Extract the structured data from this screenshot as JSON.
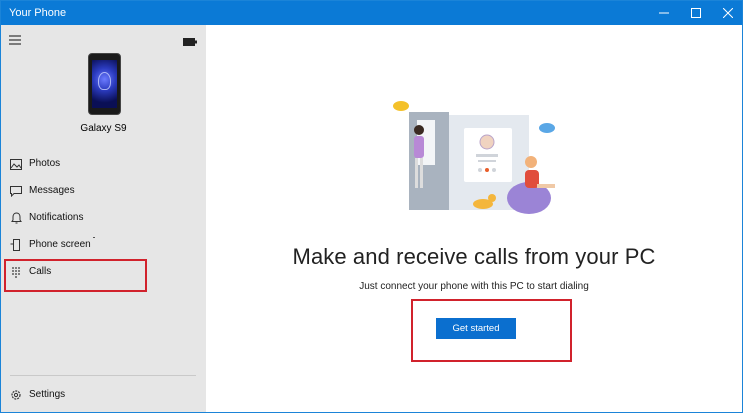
{
  "window": {
    "title": "Your Phone",
    "controls": [
      "minimize-icon",
      "maximize-icon",
      "close-icon"
    ]
  },
  "sidebar": {
    "device_name": "Galaxy S9",
    "items": [
      {
        "label": "Photos",
        "icon": "photos-icon"
      },
      {
        "label": "Messages",
        "icon": "messages-icon"
      },
      {
        "label": "Notifications",
        "icon": "bell-icon"
      },
      {
        "label": "Phone screen",
        "icon": "phone-screen-icon"
      },
      {
        "label": "Calls",
        "icon": "dialpad-icon"
      }
    ],
    "settings_label": "Settings"
  },
  "main": {
    "headline": "Make and receive calls from your PC",
    "subtext": "Just connect your phone with this PC to start dialing",
    "button_label": "Get started"
  },
  "colors": {
    "titlebar": "#0b7ad6",
    "sidebar_bg": "#e6e6e6",
    "button": "#0b6fcf",
    "annotation": "#d1222c"
  }
}
